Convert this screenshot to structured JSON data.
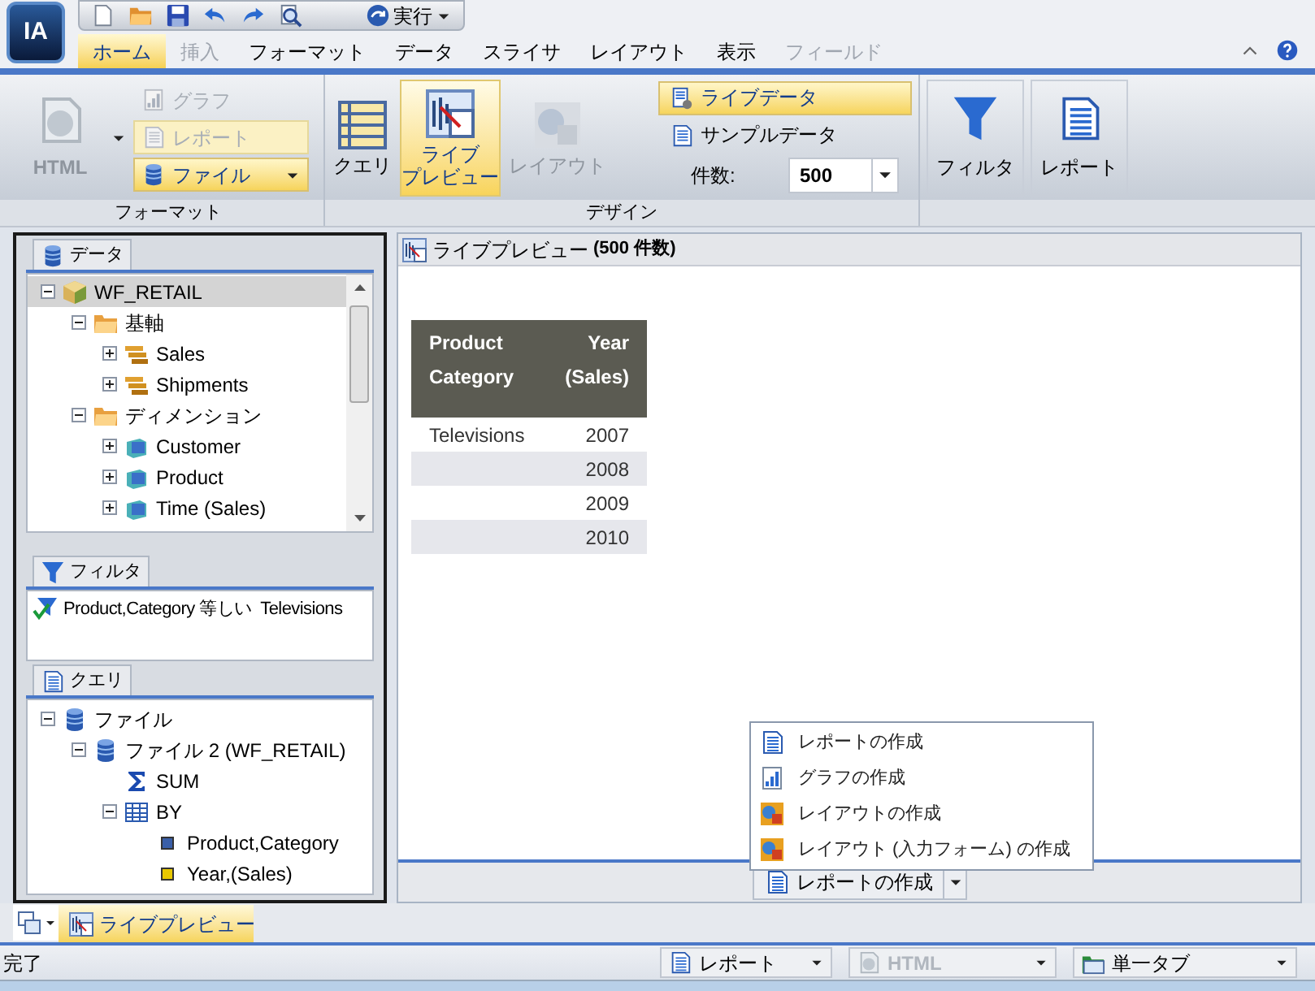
{
  "app": {
    "logo": "IA"
  },
  "quick_access": {
    "buttons": [
      {
        "kind": "new"
      },
      {
        "kind": "open"
      },
      {
        "kind": "save"
      },
      {
        "kind": "undo"
      },
      {
        "kind": "redo"
      },
      {
        "kind": "preview"
      }
    ],
    "run": {
      "label": "実行"
    }
  },
  "menu_tabs": [
    {
      "label": "ホーム",
      "selected": true,
      "disabled": false
    },
    {
      "label": "挿入",
      "selected": false,
      "disabled": true
    },
    {
      "label": "フォーマット",
      "selected": false,
      "disabled": false
    },
    {
      "label": "データ",
      "selected": false,
      "disabled": false
    },
    {
      "label": "スライサ",
      "selected": false,
      "disabled": false
    },
    {
      "label": "レイアウト",
      "selected": false,
      "disabled": false
    },
    {
      "label": "表示",
      "selected": false,
      "disabled": false
    },
    {
      "label": "フィールド",
      "selected": false,
      "disabled": true
    }
  ],
  "ribbon": {
    "format": {
      "label": "フォーマット",
      "html": {
        "label": "HTML",
        "disabled": true
      },
      "options": [
        {
          "label": "グラフ",
          "kind": "chart",
          "disabled": true,
          "selected": false
        },
        {
          "label": "レポート",
          "kind": "report",
          "disabled": true,
          "selected": true
        },
        {
          "label": "ファイル",
          "kind": "file",
          "disabled": false,
          "selected": true
        }
      ]
    },
    "design": {
      "label": "デザイン",
      "buttons": [
        {
          "lines": [
            "クエリ"
          ],
          "kind": "query",
          "selected": false,
          "disabled": false
        },
        {
          "lines": [
            "ライブ",
            "プレビュー"
          ],
          "kind": "live-preview",
          "selected": true,
          "disabled": false
        },
        {
          "lines": [
            "レイアウト"
          ],
          "kind": "layout",
          "selected": false,
          "disabled": true
        }
      ],
      "data_sources": [
        {
          "label": "ライブデータ",
          "kind": "live",
          "selected": true
        },
        {
          "label": "サンプルデータ",
          "kind": "sample",
          "selected": false
        }
      ],
      "count": {
        "label": "件数:",
        "value": "500"
      }
    },
    "tools": [
      {
        "label": "フィルタ",
        "kind": "filter"
      },
      {
        "label": "レポート",
        "kind": "report"
      }
    ]
  },
  "data_panel": {
    "title": "データ",
    "tree": [
      {
        "label": "WF_RETAIL",
        "kind": "cube",
        "expanded": true,
        "selected": true,
        "children": [
          {
            "label": "基軸",
            "kind": "folder",
            "expanded": true,
            "selected": false,
            "children": [
              {
                "label": "Sales",
                "kind": "measure",
                "expanded": false,
                "selected": false
              },
              {
                "label": "Shipments",
                "kind": "measure",
                "expanded": false,
                "selected": false
              }
            ]
          },
          {
            "label": "ディメンション",
            "kind": "folder",
            "expanded": true,
            "selected": false,
            "children": [
              {
                "label": "Customer",
                "kind": "dimension",
                "expanded": false,
                "selected": false
              },
              {
                "label": "Product",
                "kind": "dimension",
                "expanded": false,
                "selected": false
              },
              {
                "label": "Time (Sales)",
                "kind": "dimension",
                "expanded": false,
                "selected": false
              }
            ]
          }
        ]
      }
    ]
  },
  "filter_panel": {
    "title": "フィルタ",
    "items": [
      {
        "text": "Product,Category 等しい  Televisions"
      }
    ]
  },
  "query_panel": {
    "title": "クエリ",
    "tree": [
      {
        "label": "ファイル",
        "kind": "database",
        "expanded": true,
        "children": [
          {
            "label": "ファイル 2 (WF_RETAIL)",
            "kind": "database",
            "expanded": true,
            "children": [
              {
                "label": "SUM",
                "kind": "sum"
              },
              {
                "label": "BY",
                "kind": "grid",
                "expanded": true,
                "children": [
                  {
                    "label": "Product,Category",
                    "kind": "field",
                    "color": "#3a5fa8"
                  },
                  {
                    "label": "Year,(Sales)",
                    "kind": "field",
                    "color": "#e8c800"
                  }
                ]
              }
            ]
          }
        ]
      }
    ]
  },
  "preview": {
    "title": "ライブプレビュー",
    "count": "(500 件数)",
    "table": {
      "columns": [
        {
          "lines": [
            "Product",
            "Category"
          ]
        },
        {
          "lines": [
            "Year",
            "(Sales)"
          ]
        }
      ],
      "rows": [
        {
          "category": "Televisions",
          "year": "2007"
        },
        {
          "year": "2008"
        },
        {
          "year": "2009"
        },
        {
          "year": "2010"
        }
      ]
    },
    "create_menu": {
      "items": [
        {
          "label": "レポートの作成",
          "kind": "report"
        },
        {
          "label": "グラフの作成",
          "kind": "chart"
        },
        {
          "label": "レイアウトの作成",
          "kind": "layout"
        },
        {
          "label": "レイアウト (入力フォーム) の作成",
          "kind": "layout"
        }
      ]
    },
    "create_button": {
      "label": "レポートの作成"
    }
  },
  "bottom_tabs": [
    {
      "label": "ライブプレビュー",
      "selected": true
    }
  ],
  "status_bar": {
    "text": "完了",
    "selects": [
      {
        "value": "レポート",
        "kind": "report",
        "disabled": false
      },
      {
        "value": "HTML",
        "kind": "html",
        "disabled": true
      },
      {
        "value": "単一タブ",
        "kind": "single-tab",
        "disabled": false
      }
    ]
  }
}
